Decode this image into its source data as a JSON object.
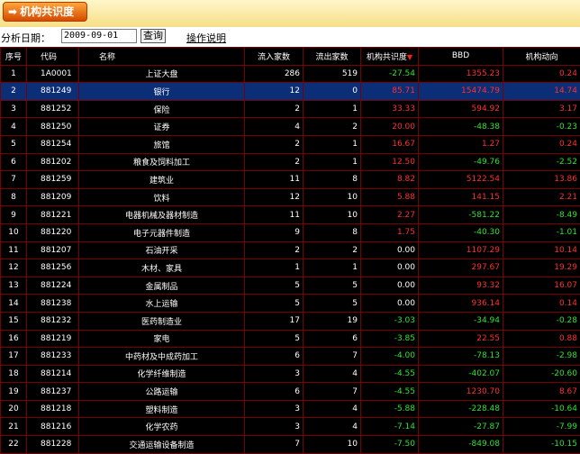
{
  "header": {
    "title": "机构共识度",
    "arrow_icon": "right-arrow-icon"
  },
  "filter": {
    "date_label": "分析日期：",
    "date_value": "2009-09-01",
    "query_button": "查询",
    "help_link": "操作说明"
  },
  "table": {
    "columns": [
      "序号",
      "代码",
      "名称",
      "流入家数",
      "流出家数",
      "机构共识度",
      "BBD",
      "机构动向"
    ],
    "sort_indicator": "▼",
    "selected_row": 2,
    "rows": [
      {
        "idx": "1",
        "code": "1A0001",
        "name": "上证大盘",
        "inflow": "286",
        "outflow": "519",
        "consensus": "-27.54",
        "bbd": "1355.23",
        "trend": "0.24"
      },
      {
        "idx": "2",
        "code": "881249",
        "name": "银行",
        "inflow": "12",
        "outflow": "0",
        "consensus": "85.71",
        "bbd": "15474.79",
        "trend": "14.74"
      },
      {
        "idx": "3",
        "code": "881252",
        "name": "保险",
        "inflow": "2",
        "outflow": "1",
        "consensus": "33.33",
        "bbd": "594.92",
        "trend": "3.17"
      },
      {
        "idx": "4",
        "code": "881250",
        "name": "证券",
        "inflow": "4",
        "outflow": "2",
        "consensus": "20.00",
        "bbd": "-48.38",
        "trend": "-0.23"
      },
      {
        "idx": "5",
        "code": "881254",
        "name": "旅馆",
        "inflow": "2",
        "outflow": "1",
        "consensus": "16.67",
        "bbd": "1.27",
        "trend": "0.24"
      },
      {
        "idx": "6",
        "code": "881202",
        "name": "粮食及饲料加工",
        "inflow": "2",
        "outflow": "1",
        "consensus": "12.50",
        "bbd": "-49.76",
        "trend": "-2.52"
      },
      {
        "idx": "7",
        "code": "881259",
        "name": "建筑业",
        "inflow": "11",
        "outflow": "8",
        "consensus": "8.82",
        "bbd": "5122.54",
        "trend": "13.86"
      },
      {
        "idx": "8",
        "code": "881209",
        "name": "饮料",
        "inflow": "12",
        "outflow": "10",
        "consensus": "5.88",
        "bbd": "141.15",
        "trend": "2.21"
      },
      {
        "idx": "9",
        "code": "881221",
        "name": "电器机械及器材制造",
        "inflow": "11",
        "outflow": "10",
        "consensus": "2.27",
        "bbd": "-581.22",
        "trend": "-8.49"
      },
      {
        "idx": "10",
        "code": "881220",
        "name": "电子元器件制造",
        "inflow": "9",
        "outflow": "8",
        "consensus": "1.75",
        "bbd": "-40.30",
        "trend": "-1.01"
      },
      {
        "idx": "11",
        "code": "881207",
        "name": "石油开采",
        "inflow": "2",
        "outflow": "2",
        "consensus": "0.00",
        "bbd": "1107.29",
        "trend": "10.14"
      },
      {
        "idx": "12",
        "code": "881256",
        "name": "木材、家具",
        "inflow": "1",
        "outflow": "1",
        "consensus": "0.00",
        "bbd": "297.67",
        "trend": "19.29"
      },
      {
        "idx": "13",
        "code": "881224",
        "name": "金属制品",
        "inflow": "5",
        "outflow": "5",
        "consensus": "0.00",
        "bbd": "93.32",
        "trend": "16.07"
      },
      {
        "idx": "14",
        "code": "881238",
        "name": "水上运输",
        "inflow": "5",
        "outflow": "5",
        "consensus": "0.00",
        "bbd": "936.14",
        "trend": "0.14"
      },
      {
        "idx": "15",
        "code": "881232",
        "name": "医药制造业",
        "inflow": "17",
        "outflow": "19",
        "consensus": "-3.03",
        "bbd": "-34.94",
        "trend": "-0.28"
      },
      {
        "idx": "16",
        "code": "881219",
        "name": "家电",
        "inflow": "5",
        "outflow": "6",
        "consensus": "-3.85",
        "bbd": "22.55",
        "trend": "0.88"
      },
      {
        "idx": "17",
        "code": "881233",
        "name": "中药材及中成药加工",
        "inflow": "6",
        "outflow": "7",
        "consensus": "-4.00",
        "bbd": "-78.13",
        "trend": "-2.98"
      },
      {
        "idx": "18",
        "code": "881214",
        "name": "化学纤维制造",
        "inflow": "3",
        "outflow": "4",
        "consensus": "-4.55",
        "bbd": "-402.07",
        "trend": "-20.60"
      },
      {
        "idx": "19",
        "code": "881237",
        "name": "公路运输",
        "inflow": "6",
        "outflow": "7",
        "consensus": "-4.55",
        "bbd": "1230.70",
        "trend": "8.67"
      },
      {
        "idx": "20",
        "code": "881218",
        "name": "塑料制造",
        "inflow": "3",
        "outflow": "4",
        "consensus": "-5.88",
        "bbd": "-228.48",
        "trend": "-10.64"
      },
      {
        "idx": "21",
        "code": "881216",
        "name": "化学农药",
        "inflow": "3",
        "outflow": "4",
        "consensus": "-7.14",
        "bbd": "-27.87",
        "trend": "-7.99"
      },
      {
        "idx": "22",
        "code": "881228",
        "name": "交通运输设备制造",
        "inflow": "7",
        "outflow": "10",
        "consensus": "-7.50",
        "bbd": "-849.08",
        "trend": "-10.15"
      }
    ]
  }
}
